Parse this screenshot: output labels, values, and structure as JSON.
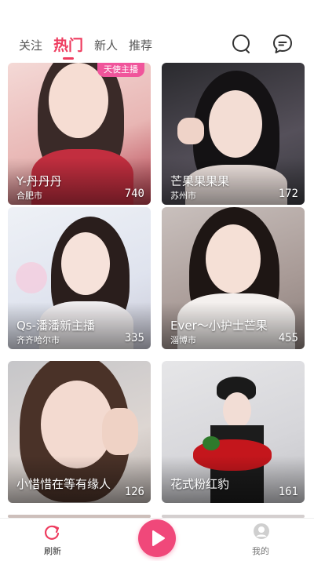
{
  "tabs": [
    {
      "label": "关注"
    },
    {
      "label": "热门"
    },
    {
      "label": "新人"
    },
    {
      "label": "推荐"
    }
  ],
  "icons": {
    "search": "search-icon",
    "message": "message-icon"
  },
  "accent": "#ee3c5f",
  "cards": [
    {
      "name": "Y-丹丹丹",
      "city": "合肥市",
      "count": "740",
      "badge": "天使主播"
    },
    {
      "name": "芒果果果果",
      "city": "苏州市",
      "count": "172"
    },
    {
      "name": "Qs-潘潘新主播",
      "city": "齐齐哈尔市",
      "count": "335"
    },
    {
      "name": "Ever～小护士芒果",
      "city": "淄博市",
      "count": "455"
    },
    {
      "name": "小惜惜在等有缘人",
      "city": "",
      "count": "126"
    },
    {
      "name": "花式粉红豹",
      "city": "",
      "count": "161"
    }
  ],
  "bottom_nav": {
    "refresh_label": "刷新",
    "mine_label": "我的"
  }
}
